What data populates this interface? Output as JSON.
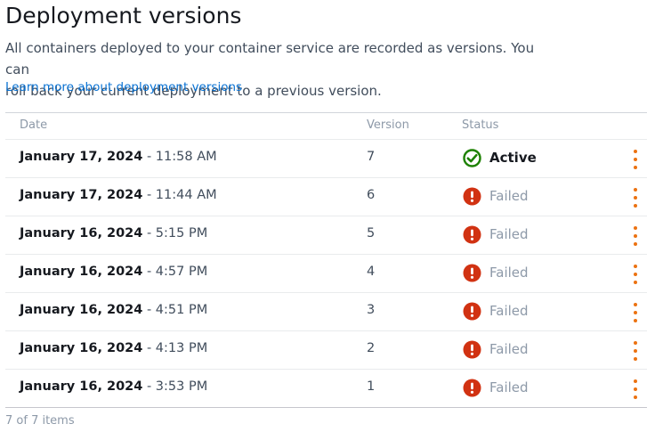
{
  "header": {
    "title": "Deployment versions",
    "description_line1": "All containers deployed to your container service are recorded as versions. You can",
    "description_line2": "roll back your current deployment to a previous version.",
    "learn_more": "Learn more about deployment versions"
  },
  "table": {
    "columns": {
      "date": "Date",
      "version": "Version",
      "status": "Status"
    },
    "rows": [
      {
        "date": "January 17, 2024",
        "time": " - 11:58 AM",
        "version": "7",
        "status": "Active"
      },
      {
        "date": "January 17, 2024",
        "time": " - 11:44 AM",
        "version": "6",
        "status": "Failed"
      },
      {
        "date": "January 16, 2024",
        "time": " - 5:15 PM",
        "version": "5",
        "status": "Failed"
      },
      {
        "date": "January 16, 2024",
        "time": " - 4:57 PM",
        "version": "4",
        "status": "Failed"
      },
      {
        "date": "January 16, 2024",
        "time": " - 4:51 PM",
        "version": "3",
        "status": "Failed"
      },
      {
        "date": "January 16, 2024",
        "time": " - 4:13 PM",
        "version": "2",
        "status": "Failed"
      },
      {
        "date": "January 16, 2024",
        "time": " - 3:53 PM",
        "version": "1",
        "status": "Failed"
      }
    ],
    "footer": "7 of 7 items"
  },
  "colors": {
    "active": "#1d8102",
    "failed": "#d13212",
    "menu": "#ec7211",
    "link": "#0972d3"
  },
  "icons": {
    "active": "check-circle-icon",
    "failed": "exclamation-circle-icon",
    "menu": "vertical-ellipsis-icon"
  }
}
